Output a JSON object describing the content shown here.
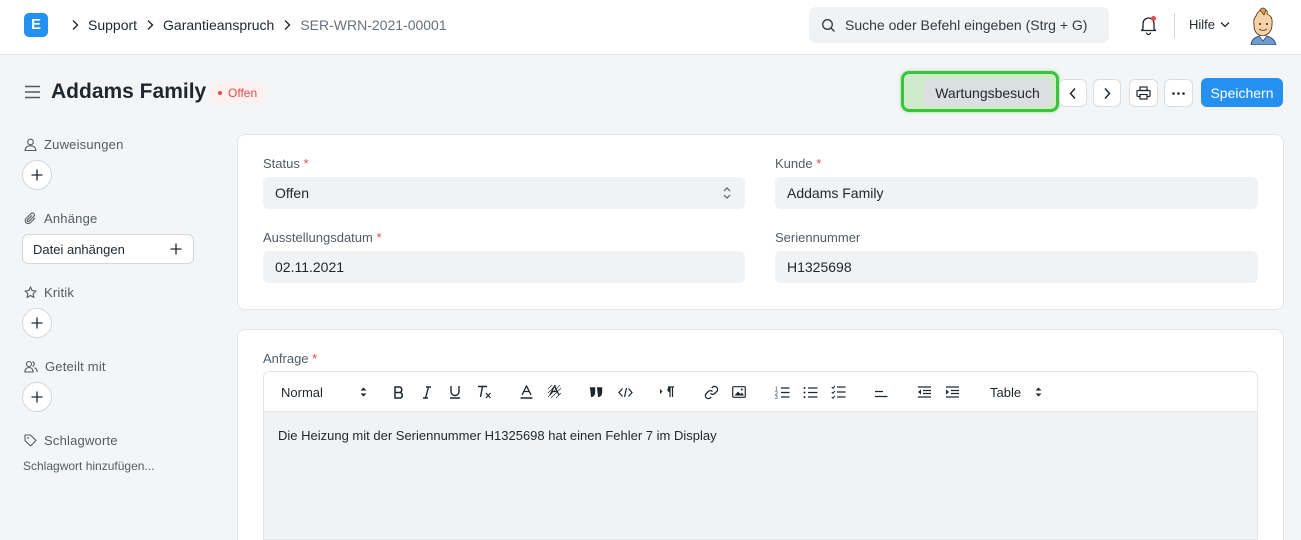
{
  "nav": {
    "logo_letter": "E",
    "breadcrumbs": [
      "Support",
      "Garantieanspruch",
      "SER-WRN-2021-00001"
    ],
    "search_placeholder": "Suche oder Befehl eingeben (Strg + G)",
    "help_label": "Hilfe"
  },
  "header": {
    "title": "Addams Family",
    "status": "Offen",
    "maintenance_button": "Wartungsbesuch",
    "save_button": "Speichern"
  },
  "sidebar": {
    "assignments": "Zuweisungen",
    "attachments": "Anhänge",
    "attach_file": "Datei anhängen",
    "review": "Kritik",
    "shared_with": "Geteilt mit",
    "tags": "Schlagworte",
    "add_tag": "Schlagwort hinzufügen..."
  },
  "form": {
    "status_label": "Status",
    "status_value": "Offen",
    "customer_label": "Kunde",
    "customer_value": "Addams Family",
    "date_label": "Ausstellungsdatum",
    "date_value": "02.11.2021",
    "serial_label": "Seriennummer",
    "serial_value": "H1325698",
    "request_label": "Anfrage",
    "required_mark": "*"
  },
  "editor": {
    "style_select": "Normal",
    "table_select": "Table",
    "content": "Die Heizung mit der Seriennummer H1325698 hat einen Fehler 7 im Display"
  },
  "colors": {
    "primary": "#2490ef",
    "status_red": "#e24c4c",
    "highlight_green": "#3bc43b"
  }
}
